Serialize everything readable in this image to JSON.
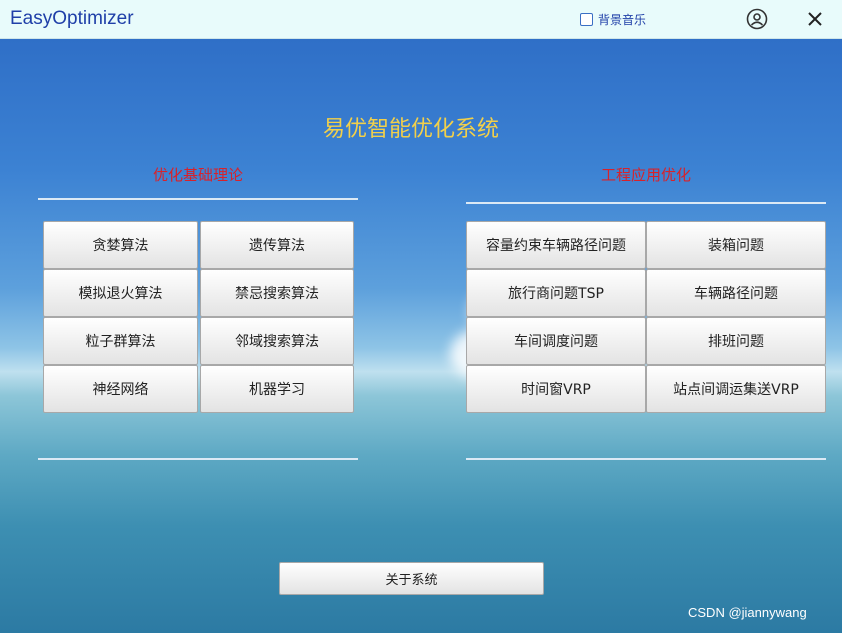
{
  "window": {
    "title": "EasyOptimizer"
  },
  "titlebar": {
    "bgm_label": "背景音乐",
    "bgm_checked": false,
    "user_icon": "user-circle-icon",
    "close_icon": "close-icon"
  },
  "main": {
    "title": "易优智能优化系统",
    "left_section": {
      "title": "优化基础理论",
      "buttons": [
        "贪婪算法",
        "遗传算法",
        "模拟退火算法",
        "禁忌搜索算法",
        "粒子群算法",
        "邻域搜索算法",
        "神经网络",
        "机器学习"
      ]
    },
    "right_section": {
      "title": "工程应用优化",
      "buttons": [
        "容量约束车辆路径问题",
        "装箱问题",
        "旅行商问题TSP",
        "车辆路径问题",
        "车间调度问题",
        "排班问题",
        "时间窗VRP",
        "站点间调运集送VRP"
      ]
    },
    "about_button": "关于系统"
  },
  "watermark": "CSDN @jiannywang",
  "colors": {
    "title_yellow": "#f2d04a",
    "section_red": "#d8222a",
    "titlebar_bg": "#e8fbfb",
    "title_blue": "#1f3fa8"
  }
}
